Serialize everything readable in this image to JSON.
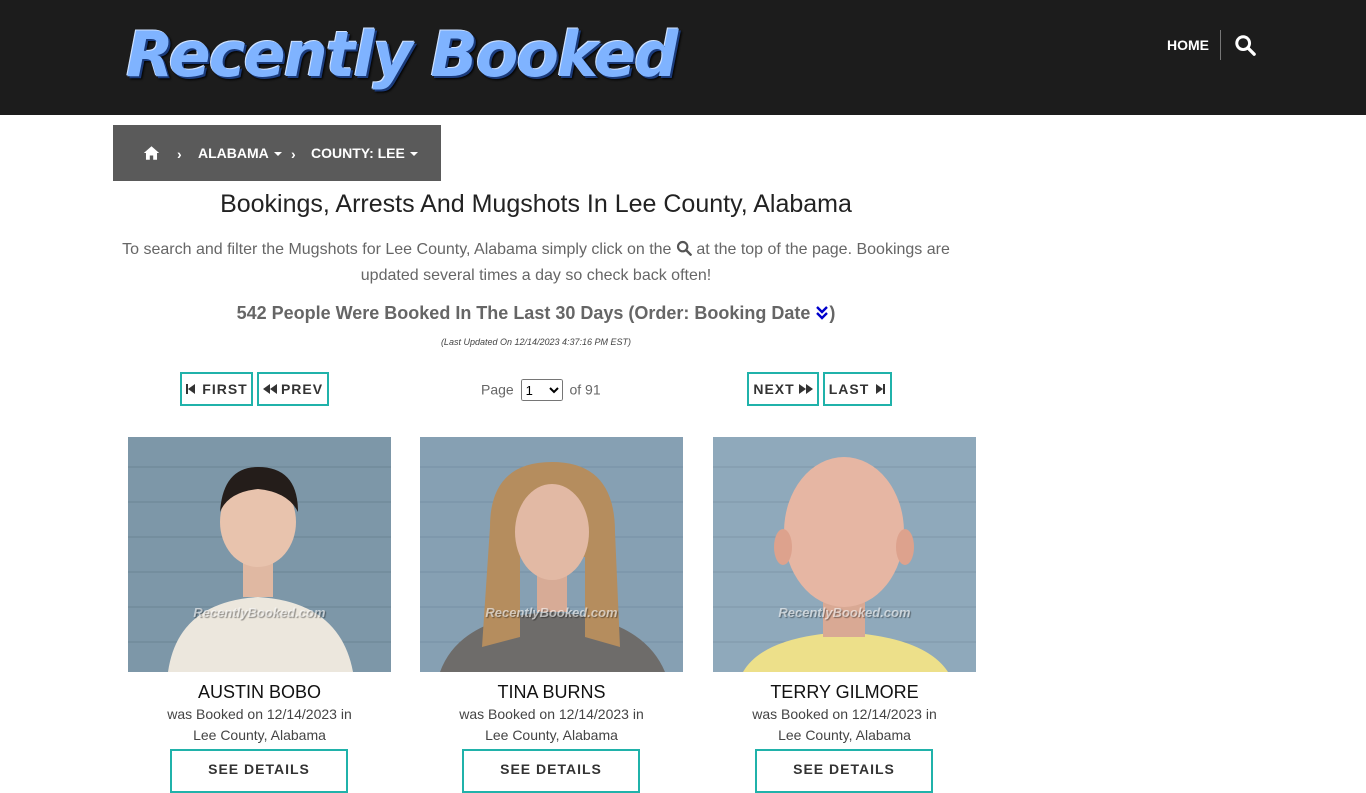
{
  "header": {
    "logo_text": "Recently Booked",
    "nav_home": "HOME",
    "search_icon": "search-icon"
  },
  "breadcrumb": {
    "home_icon": "home-icon",
    "state": "ALABAMA",
    "county": "COUNTY: LEE"
  },
  "main": {
    "title": "Bookings, Arrests And Mugshots In Lee County, Alabama",
    "intro_part1": "To search and filter the Mugshots for Lee County, Alabama simply click on the",
    "intro_part2": "at the top of the page. Bookings are updated several times a day so check back often!",
    "count_text": "542 People Were Booked In The Last 30 Days (Order: Booking Date",
    "count_close": ")",
    "last_updated": "(Last Updated On 12/14/2023 4:37:16 PM EST)"
  },
  "pagination": {
    "first": "FIRST",
    "prev": "PREV",
    "next": "NEXT",
    "last": "LAST",
    "page_label": "Page",
    "current_page": "1",
    "of_label": "of 91"
  },
  "watermark": "RecentlyBooked.com",
  "bookings": [
    {
      "name": "AUSTIN BOBO",
      "booked_line1": "was Booked on 12/14/2023 in",
      "booked_line2": "Lee County, Alabama",
      "details_label": "SEE DETAILS"
    },
    {
      "name": "TINA BURNS",
      "booked_line1": "was Booked on 12/14/2023 in",
      "booked_line2": "Lee County, Alabama",
      "details_label": "SEE DETAILS"
    },
    {
      "name": "TERRY GILMORE",
      "booked_line1": "was Booked on 12/14/2023 in",
      "booked_line2": "Lee County, Alabama",
      "details_label": "SEE DETAILS"
    }
  ],
  "colors": {
    "header_bg": "#1c1c1c",
    "breadcrumb_bg": "#5a5a5a",
    "accent_teal": "#20b2aa",
    "sort_blue": "#0000cc"
  }
}
